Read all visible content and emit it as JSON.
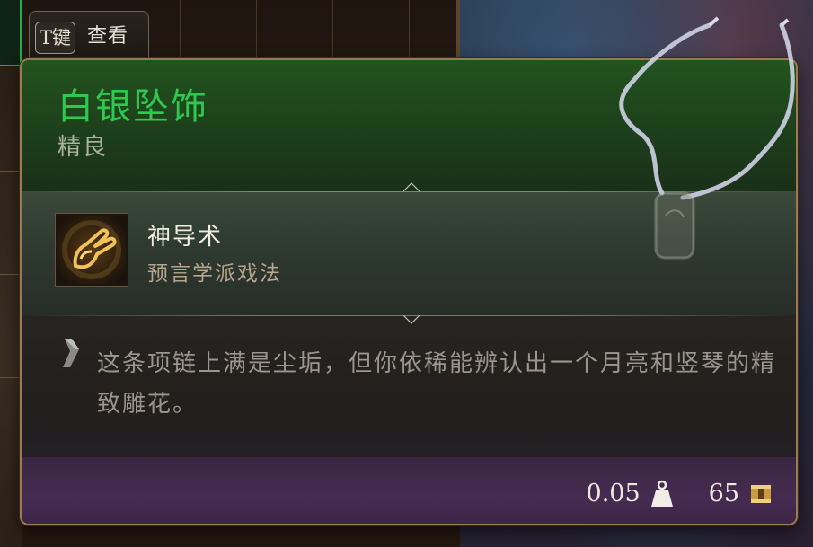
{
  "hint": {
    "key": "T键",
    "label": "查看"
  },
  "item": {
    "name": "白银坠饰",
    "rarity": "精良"
  },
  "spell": {
    "icon": "guidance-spell-icon",
    "name": "神导术",
    "school": "预言学派戏法"
  },
  "description": {
    "text": "这条项链上满是尘垢，但你依稀能辨认出一个月亮和竖琴的精致雕花。"
  },
  "footer": {
    "weight": "0.05",
    "weight_icon": "weight-icon",
    "price": "65",
    "price_icon": "gold-coin-icon"
  },
  "colors": {
    "rarity_green": "#2fc94f",
    "panel_border": "#9a7a52",
    "footer_purple": "#452b50"
  }
}
